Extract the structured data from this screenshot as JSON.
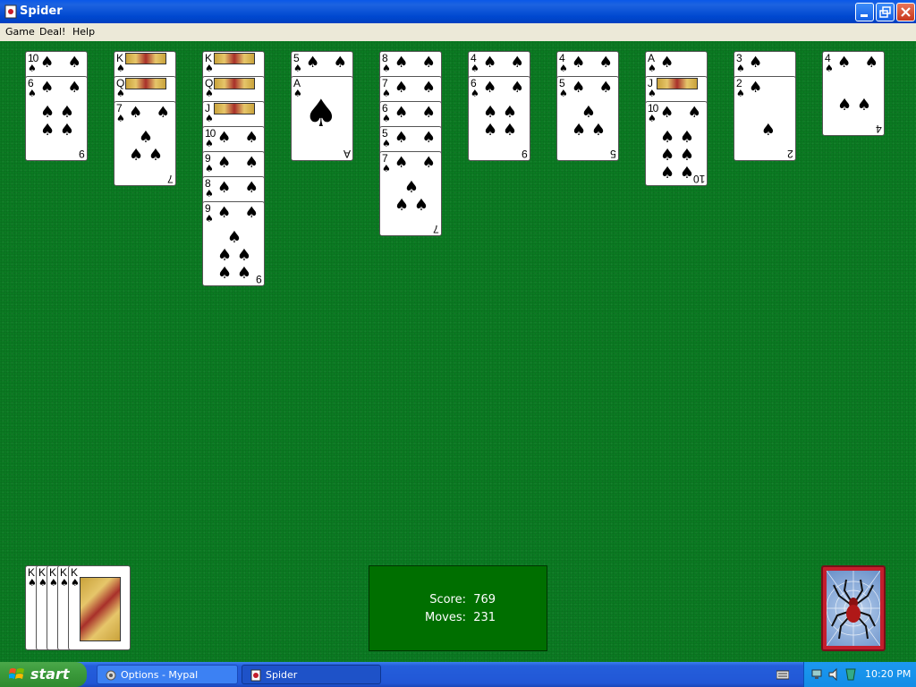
{
  "window": {
    "title": "Spider"
  },
  "menu": {
    "game": "Game",
    "deal": "Deal!",
    "help": "Help"
  },
  "tableau": [
    {
      "cards": [
        {
          "rank": "10",
          "pips": "♠ ♠"
        },
        {
          "rank": "6",
          "pips": "♠ ♠\n♠ ♠\n♠ ♠",
          "bottom": "9"
        }
      ]
    },
    {
      "cards": [
        {
          "rank": "K",
          "face": true
        },
        {
          "rank": "Q",
          "face": true
        },
        {
          "rank": "7",
          "pips": "♠ ♠\n ♠ \n♠ ♠",
          "bottom": "7"
        }
      ]
    },
    {
      "cards": [
        {
          "rank": "K",
          "face": true
        },
        {
          "rank": "Q",
          "face": true
        },
        {
          "rank": "J",
          "face": true
        },
        {
          "rank": "10",
          "pips": "♠ ♠"
        },
        {
          "rank": "9",
          "pips": "♠ ♠"
        },
        {
          "rank": "8",
          "pips": "♠ ♠"
        },
        {
          "rank": "9",
          "pips": "♠ ♠\n ♠ \n♠ ♠\n♠ ♠",
          "bottom": "9"
        }
      ]
    },
    {
      "cards": [
        {
          "rank": "5",
          "pips": "♠ ♠"
        },
        {
          "rank": "A",
          "ace": true,
          "bottom": "A"
        }
      ]
    },
    {
      "cards": [
        {
          "rank": "8",
          "pips": "♠ ♠"
        },
        {
          "rank": "7",
          "pips": "♠ ♠"
        },
        {
          "rank": "6",
          "pips": "♠ ♠"
        },
        {
          "rank": "5",
          "pips": "♠ ♠"
        },
        {
          "rank": "7",
          "pips": "♠ ♠\n ♠ \n♠ ♠",
          "bottom": "7"
        }
      ]
    },
    {
      "cards": [
        {
          "rank": "4",
          "pips": "♠ ♠"
        },
        {
          "rank": "6",
          "pips": "♠ ♠\n♠ ♠\n♠ ♠",
          "bottom": "9"
        }
      ]
    },
    {
      "cards": [
        {
          "rank": "4",
          "pips": "♠ ♠"
        },
        {
          "rank": "5",
          "pips": "♠ ♠\n ♠ \n♠ ♠",
          "bottom": "5"
        }
      ]
    },
    {
      "cards": [
        {
          "rank": "A",
          "pips": " ♠"
        },
        {
          "rank": "J",
          "face": true
        },
        {
          "rank": "10",
          "pips": "♠ ♠\n♠ ♠\n♠ ♠\n♠ ♠",
          "bottom": "10"
        }
      ]
    },
    {
      "cards": [
        {
          "rank": "3",
          "pips": " ♠"
        },
        {
          "rank": "2",
          "pips": " ♠\n\n ♠",
          "bottom": "2"
        }
      ]
    },
    {
      "cards": [
        {
          "rank": "4",
          "pips": "♠ ♠\n\n♠ ♠",
          "bottom": "4"
        }
      ]
    }
  ],
  "completed_ranks": [
    "K",
    "K",
    "K",
    "K",
    "K"
  ],
  "score": {
    "score_label": "Score:",
    "score_value": "769",
    "moves_label": "Moves:",
    "moves_value": "231"
  },
  "taskbar": {
    "start": "start",
    "tasks": [
      {
        "label": "Options - Mypal"
      },
      {
        "label": "Spider"
      }
    ],
    "clock": "10:20 PM"
  }
}
